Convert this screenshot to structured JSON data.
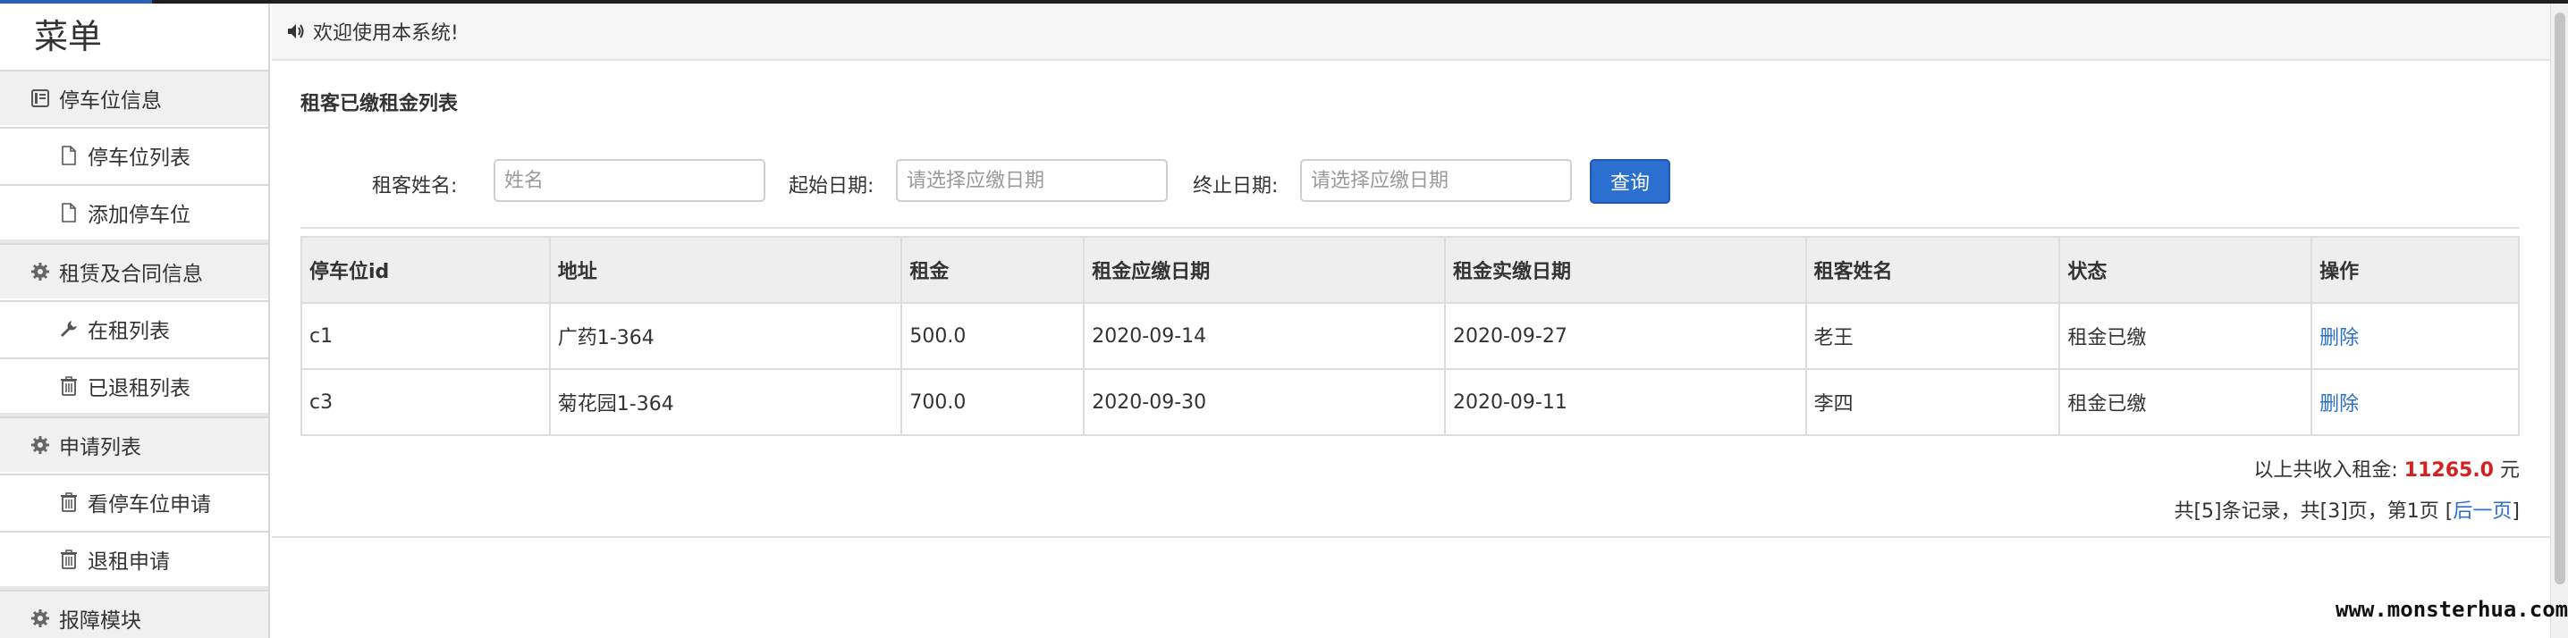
{
  "sidebar": {
    "title": "菜单",
    "groups": [
      {
        "label": "停车位信息",
        "icon": "book-icon"
      },
      {
        "label": "租赁及合同信息",
        "icon": "gear-icon"
      },
      {
        "label": "申请列表",
        "icon": "gear-icon"
      },
      {
        "label": "报障模块",
        "icon": "gear-icon"
      }
    ],
    "items": [
      {
        "label": "停车位列表",
        "icon": "file-icon"
      },
      {
        "label": "添加停车位",
        "icon": "file-icon"
      },
      {
        "label": "在租列表",
        "icon": "wrench-icon"
      },
      {
        "label": "已退租列表",
        "icon": "trash-icon"
      },
      {
        "label": "看停车位申请",
        "icon": "trash-icon"
      },
      {
        "label": "退租申请",
        "icon": "trash-icon"
      }
    ]
  },
  "notice": {
    "text": "欢迎使用本系统!",
    "icon": "volume-icon"
  },
  "panel": {
    "title": "租客已缴租金列表"
  },
  "search": {
    "name_label": "租客姓名:",
    "name_placeholder": "姓名",
    "start_label": "起始日期:",
    "start_placeholder": "请选择应缴日期",
    "end_label": "终止日期:",
    "end_placeholder": "请选择应缴日期",
    "query_label": "查询"
  },
  "table": {
    "headers": [
      "停车位id",
      "地址",
      "租金",
      "租金应缴日期",
      "租金实缴日期",
      "租客姓名",
      "状态",
      "操作"
    ],
    "rows": [
      [
        "c1",
        "广药1-364",
        "500.0",
        "2020-09-14",
        "2020-09-27",
        "老王",
        "租金已缴",
        "删除"
      ],
      [
        "c3",
        "菊花园1-364",
        "700.0",
        "2020-09-30",
        "2020-09-11",
        "李四",
        "租金已缴",
        "删除"
      ]
    ]
  },
  "summary": {
    "prefix": "以上共收入租金:",
    "amount": "11265.0",
    "suffix": "元"
  },
  "pager": {
    "text": "共[5]条记录，共[3]页，第1页",
    "open_bracket": "[",
    "next_label": "后一页",
    "close_bracket": "]"
  },
  "watermark": "www.monsterhua.com",
  "colors": {
    "accent": "#2b6fd0",
    "link": "#2a6fc9",
    "amount": "#d42020"
  }
}
